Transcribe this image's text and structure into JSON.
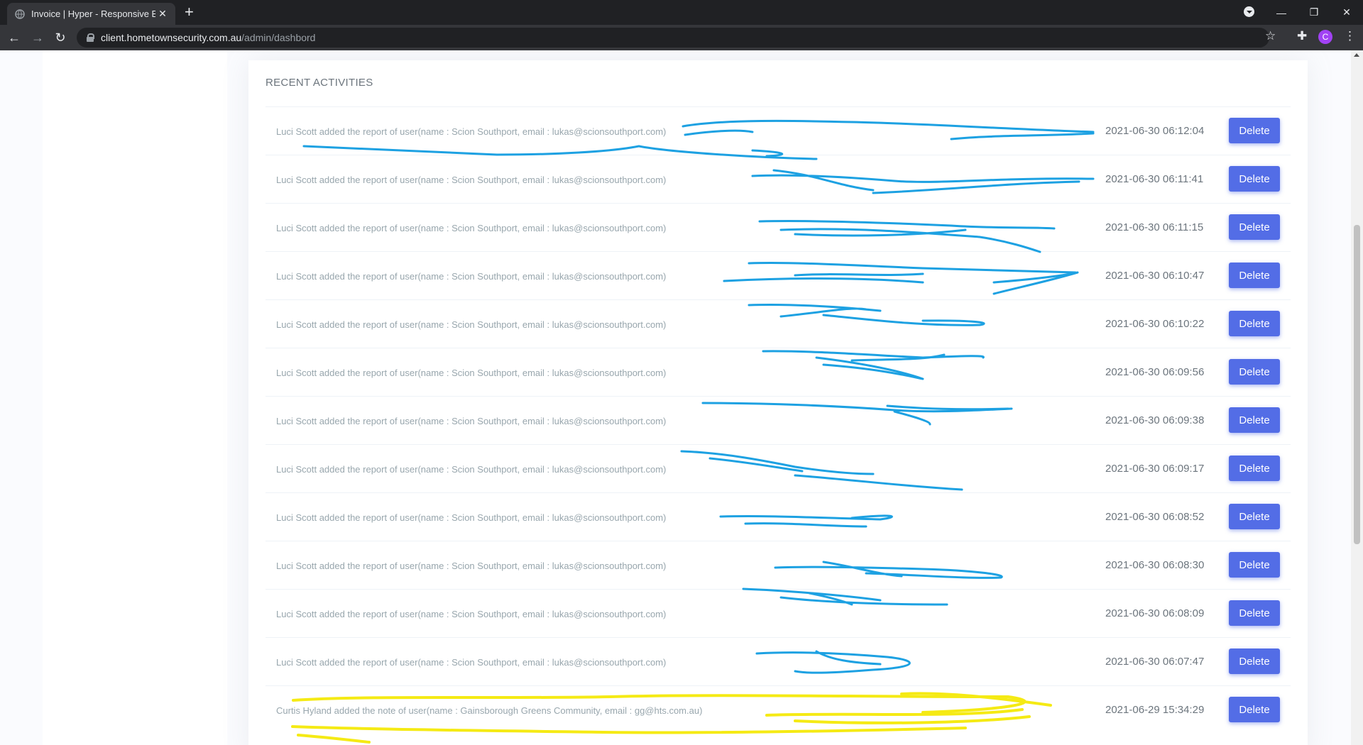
{
  "browser": {
    "tab_title": "Invoice | Hyper - Responsive Boo",
    "tab_close": "✕",
    "new_tab": "+",
    "url_host": "client.hometownsecurity.com.au",
    "url_path": "/admin/dashbord",
    "profile_initial": "C",
    "window": {
      "minimize": "—",
      "restore": "❐",
      "close": "✕"
    }
  },
  "card": {
    "title": "RECENT ACTIVITIES"
  },
  "delete_label": "Delete",
  "activities": [
    {
      "message": "Luci Scott added the report of user(name : Scion Southport, email : lukas@scionsouthport.com)",
      "time": "2021-06-30 06:12:04"
    },
    {
      "message": "Luci Scott added the report of user(name : Scion Southport, email : lukas@scionsouthport.com)",
      "time": "2021-06-30 06:11:41"
    },
    {
      "message": "Luci Scott added the report of user(name : Scion Southport, email : lukas@scionsouthport.com)",
      "time": "2021-06-30 06:11:15"
    },
    {
      "message": "Luci Scott added the report of user(name : Scion Southport, email : lukas@scionsouthport.com)",
      "time": "2021-06-30 06:10:47"
    },
    {
      "message": "Luci Scott added the report of user(name : Scion Southport, email : lukas@scionsouthport.com)",
      "time": "2021-06-30 06:10:22"
    },
    {
      "message": "Luci Scott added the report of user(name : Scion Southport, email : lukas@scionsouthport.com)",
      "time": "2021-06-30 06:09:56"
    },
    {
      "message": "Luci Scott added the report of user(name : Scion Southport, email : lukas@scionsouthport.com)",
      "time": "2021-06-30 06:09:38"
    },
    {
      "message": "Luci Scott added the report of user(name : Scion Southport, email : lukas@scionsouthport.com)",
      "time": "2021-06-30 06:09:17"
    },
    {
      "message": "Luci Scott added the report of user(name : Scion Southport, email : lukas@scionsouthport.com)",
      "time": "2021-06-30 06:08:52"
    },
    {
      "message": "Luci Scott added the report of user(name : Scion Southport, email : lukas@scionsouthport.com)",
      "time": "2021-06-30 06:08:30"
    },
    {
      "message": "Luci Scott added the report of user(name : Scion Southport, email : lukas@scionsouthport.com)",
      "time": "2021-06-30 06:08:09"
    },
    {
      "message": "Luci Scott added the report of user(name : Scion Southport, email : lukas@scionsouthport.com)",
      "time": "2021-06-30 06:07:47"
    },
    {
      "message": "Curtis Hyland added the note of user(name : Gainsborough Greens Community, email : gg@hts.com.au)",
      "time": "2021-06-29 15:34:29"
    }
  ],
  "colors": {
    "accent": "#536de6",
    "scribble_blue": "#1da1e2",
    "scribble_yellow": "#f5ea14"
  }
}
